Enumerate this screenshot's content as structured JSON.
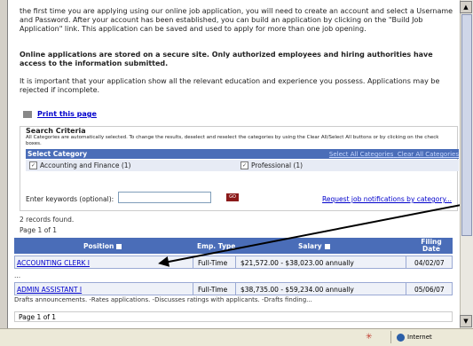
{
  "intro_text": "the first time you are applying using our online job application, you will need to create an account and select a Username and Password. After your account has been established, you can build an application by clicking on the \"Build Job Application\" link. This application can be saved and used to apply for more than one job opening.",
  "secure_notice": "Online applications are stored on a secure site. Only authorized employees and hiring authorities have access to the information submitted.",
  "important_text": "It is important that your application show all the relevant education and experience you possess. Applications may be rejected if incomplete.",
  "print_link": "Print this page",
  "search": {
    "title": "Search Criteria",
    "help": "All Categories are automatically selected. To change the results, deselect and reselect the categories by using the Clear All/Select All buttons or by clicking on the check boxes.",
    "category_header": "Select Category",
    "select_all": "Select All Categories",
    "clear_all": "Clear All Categories",
    "categories": [
      {
        "label": "Accounting and Finance (1)",
        "checked": true
      },
      {
        "label": "Professional (1)",
        "checked": true
      }
    ],
    "keyword_label": "Enter keywords (optional):",
    "keyword_value": "",
    "go_label": "GO",
    "notify_link": "Request job notifications by category..."
  },
  "results": {
    "records_found": "2 records found.",
    "page_info": "Page 1 of 1",
    "columns": [
      "Position",
      "Emp. Type",
      "Salary",
      "Filing Date"
    ],
    "rows": [
      {
        "position": "ACCOUNTING CLERK I",
        "emp_type": "Full-Time",
        "salary": "$21,572.00 - $38,023.00 annually",
        "filing_date": "04/02/07"
      },
      {
        "position": "ADMIN ASSISTANT I",
        "emp_type": "Full-Time",
        "salary": "$38,735.00 - $59,234.00 annually",
        "filing_date": "05/06/07"
      }
    ],
    "ellipsis": "...",
    "row2_description": "Drafts announcements. -Rates applications. -Discusses ratings with applicants. -Drafts finding...",
    "page_info_bottom": "Page 1 of 1"
  },
  "status_bar": {
    "zone": "Internet"
  }
}
